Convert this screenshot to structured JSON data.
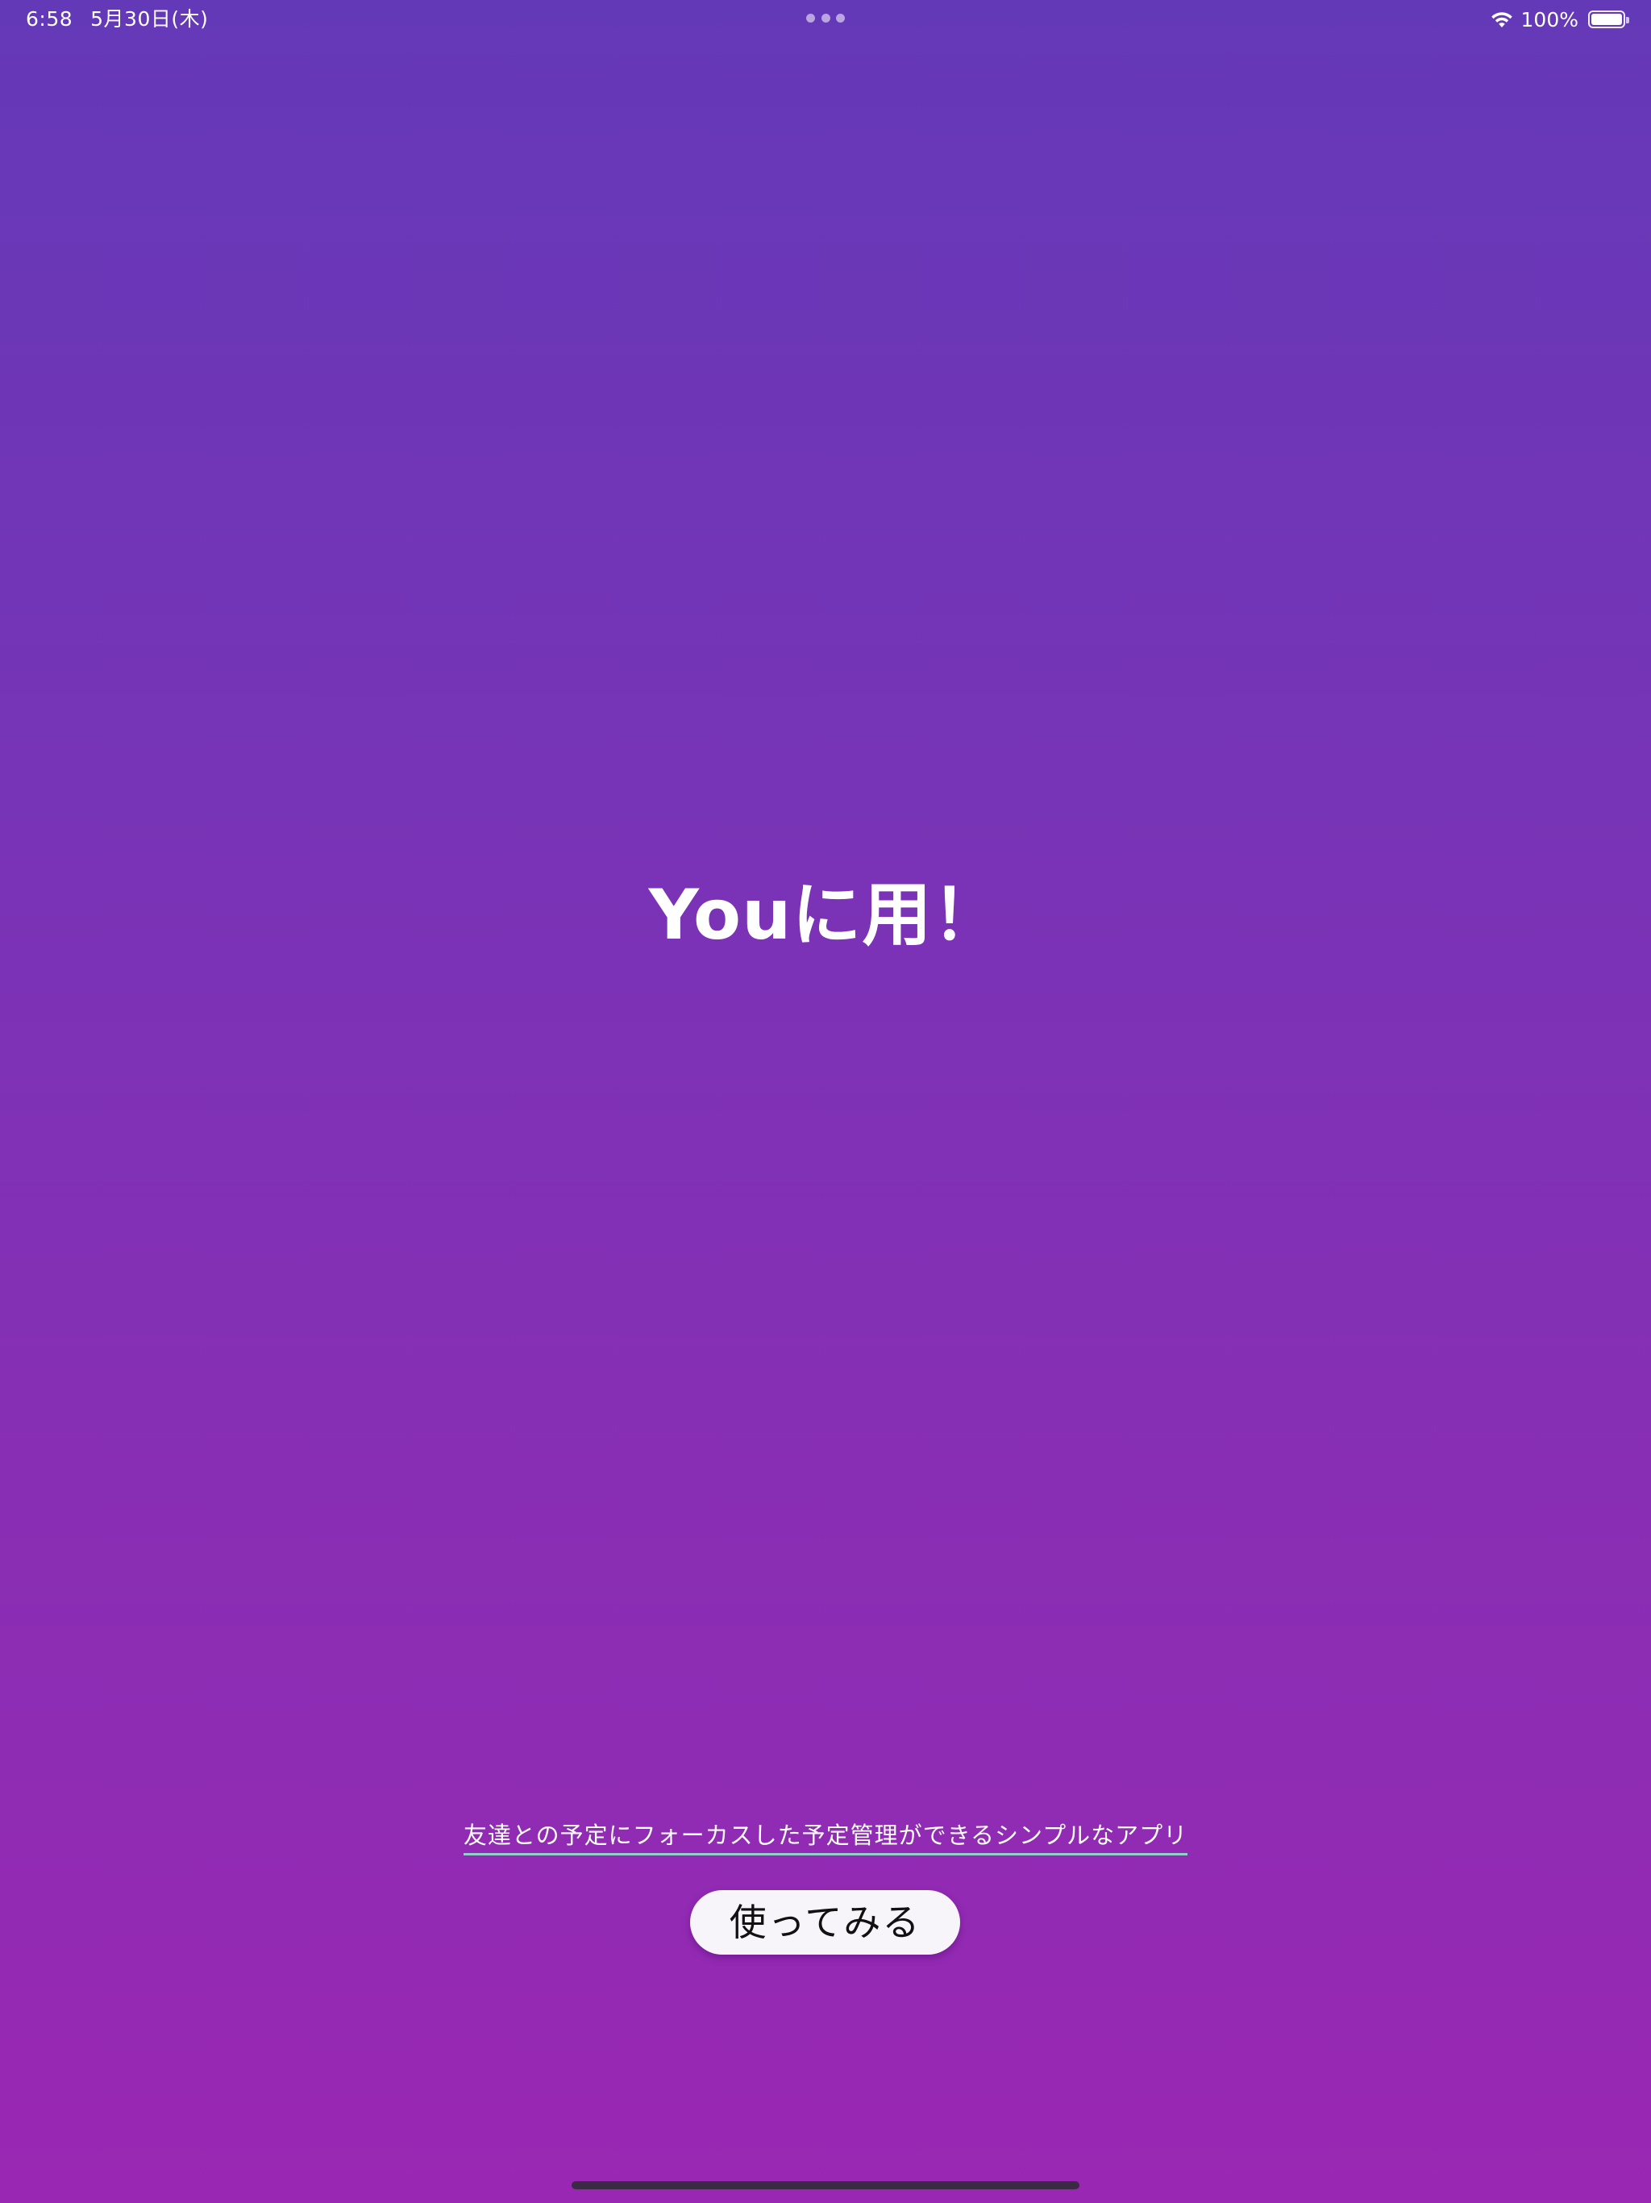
{
  "status_bar": {
    "time": "6:58",
    "date": "5月30日(木)",
    "battery_percent": "100%",
    "wifi_icon": "wifi-icon",
    "battery_icon": "battery-icon",
    "battery_level": 1.0
  },
  "main": {
    "headline": "Youに用！",
    "tagline": "友達との予定にフォーカスした予定管理ができるシンプルなアプリ",
    "try_button_label": "使ってみる"
  },
  "colors": {
    "gradient_top": "#6439b8",
    "gradient_bottom": "#9a27b3",
    "button_bg": "#f7f5fa",
    "tagline_underline": "#8fd0c8"
  }
}
